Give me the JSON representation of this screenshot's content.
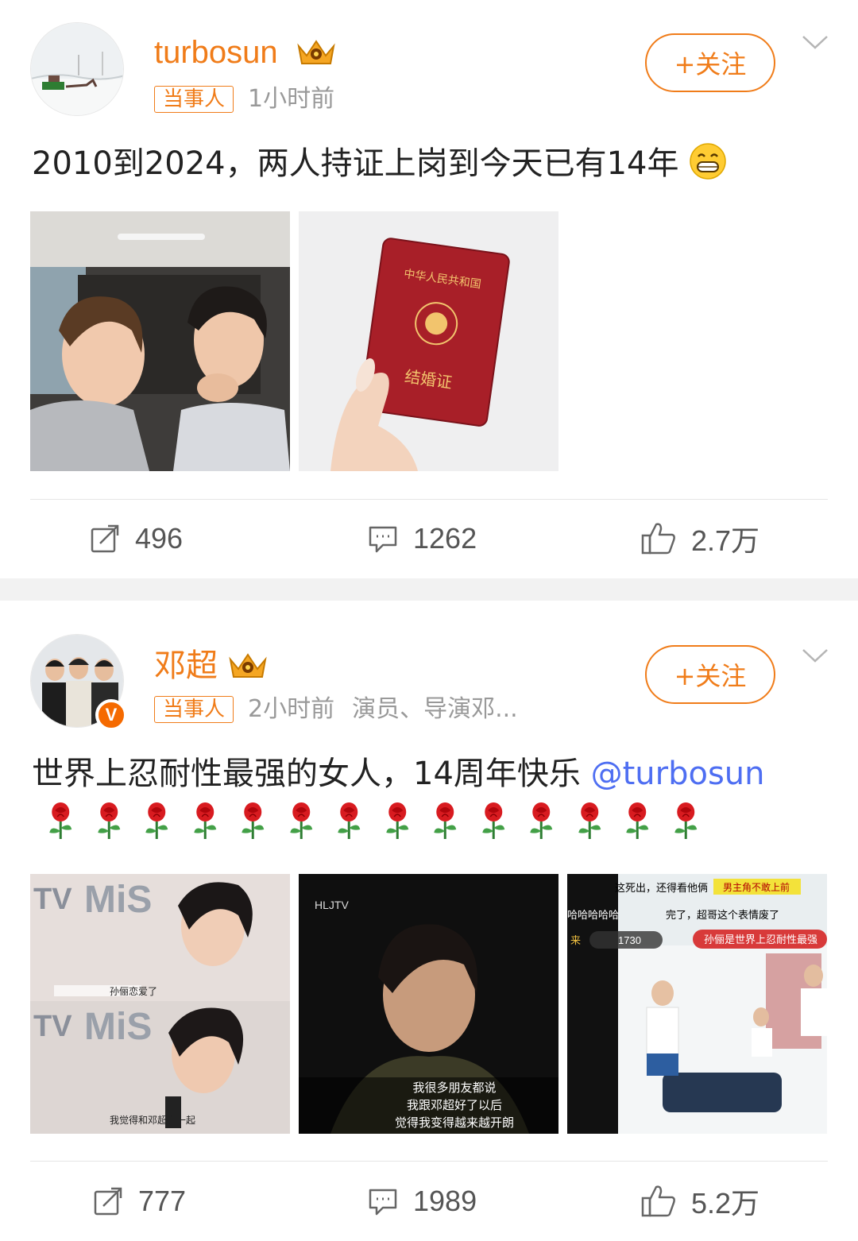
{
  "posts": [
    {
      "username": "turbosun",
      "tag": "当事人",
      "time": "1小时前",
      "bio": "",
      "follow_label": "+关注",
      "text": "2010到2024，两人持证上岗到今天已有14年",
      "mention": "",
      "emoji": "grin-emoji",
      "images": [
        {
          "desc": "couple-selfie-in-car"
        },
        {
          "desc": "hand-holding-red-marriage-certificate",
          "cert_title": "中华人民共和国",
          "cert_label": "结婚证"
        }
      ],
      "stats": {
        "reposts": "496",
        "comments": "1262",
        "likes": "2.7万"
      }
    },
    {
      "username": "邓超",
      "tag": "当事人",
      "time": "2小时前",
      "bio": "演员、导演邓...",
      "verified": "V",
      "follow_label": "+关注",
      "text": "世界上忍耐性最强的女人，14周年快乐 ",
      "mention": "@turbosun",
      "rose_count": 14,
      "images": [
        {
          "desc": "interview-screenshots",
          "cap1": "孙俪恋爱了",
          "cap2": "我觉得和邓超在一起"
        },
        {
          "desc": "tv-interview-frame",
          "logo": "HLJTV",
          "cap1": "我很多朋友都说",
          "cap2": "我跟邓超好了以后",
          "cap3": "觉得我变得越来越开朗"
        },
        {
          "desc": "variety-show-screenshot",
          "cap1": "这死出，还得看他俩",
          "cap2": "男主角不敢上前",
          "cap3": "哈哈哈哈哈",
          "cap4": "完了，超哥这个表情废了",
          "cap5": "孙俪是世界上忍耐性最强",
          "cap6": "来",
          "cap7": "1730"
        }
      ],
      "stats": {
        "reposts": "777",
        "comments": "1989",
        "likes": "5.2万"
      }
    }
  ],
  "colors": {
    "accent": "#f07c19",
    "mention": "#4e6ef2",
    "text": "#222222",
    "muted": "#999999"
  }
}
